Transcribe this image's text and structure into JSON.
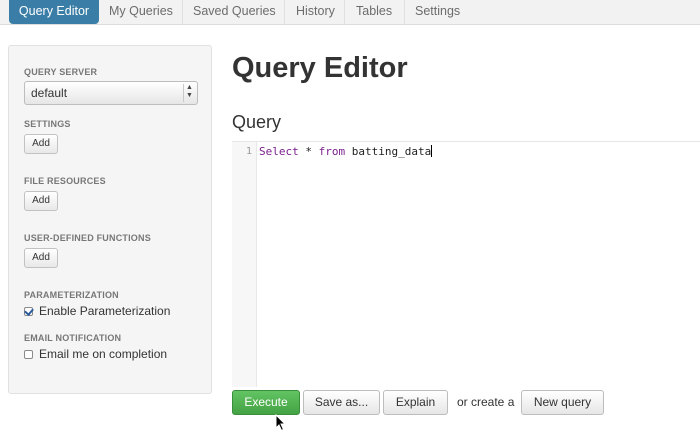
{
  "nav": {
    "tabs": [
      {
        "label": "Query Editor",
        "active": true
      },
      {
        "label": "My Queries"
      },
      {
        "label": "Saved Queries"
      },
      {
        "label": "History"
      },
      {
        "label": "Tables"
      },
      {
        "label": "Settings"
      }
    ]
  },
  "sidebar": {
    "query_server_label": "QUERY SERVER",
    "query_server_value": "default",
    "settings_label": "SETTINGS",
    "file_resources_label": "FILE RESOURCES",
    "udf_label": "USER-DEFINED FUNCTIONS",
    "add_label": "Add",
    "parameterization_label": "PARAMETERIZATION",
    "enable_parameterization": "Enable Parameterization",
    "enable_parameterization_checked": true,
    "email_notification_label": "EMAIL NOTIFICATION",
    "email_me": "Email me on completion",
    "email_me_checked": false
  },
  "main": {
    "title": "Query Editor",
    "section": "Query",
    "editor": {
      "line_number": "1",
      "kw_select": "Select",
      "star": " * ",
      "kw_from": "from",
      "table": " batting_data"
    },
    "buttons": {
      "execute": "Execute",
      "save_as": "Save as...",
      "explain": "Explain",
      "or_create": "or create a",
      "new_query": "New query"
    }
  },
  "colors": {
    "active_tab": "#3a7ea8",
    "execute": "#4cae4c",
    "keyword": "#7a1f8c"
  }
}
